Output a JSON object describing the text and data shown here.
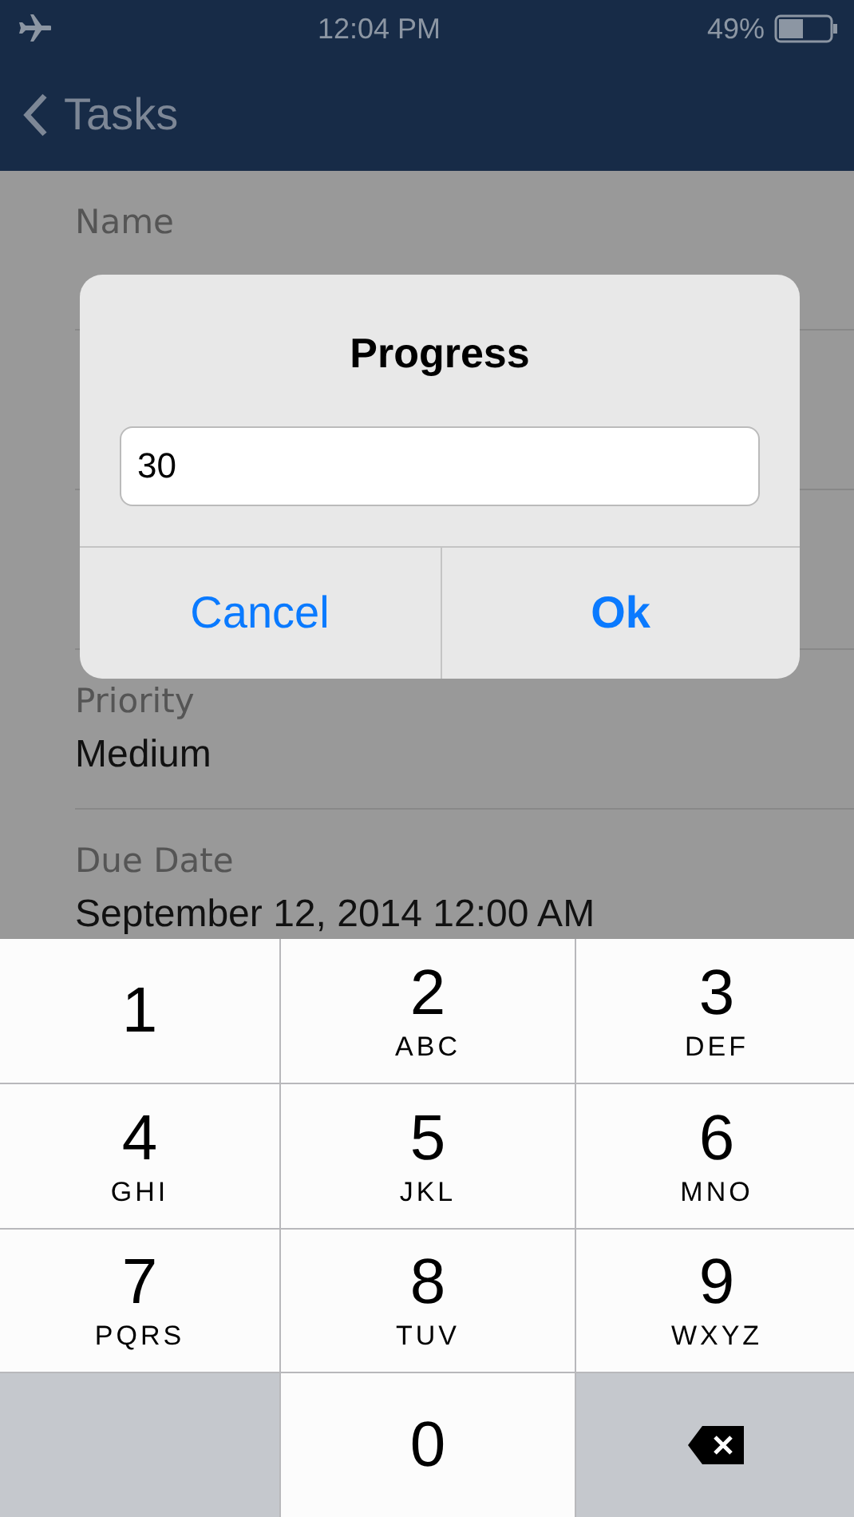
{
  "status_bar": {
    "time": "12:04 PM",
    "battery": "49%"
  },
  "nav": {
    "back_label": "Tasks"
  },
  "fields": [
    {
      "label": "Name",
      "kind": "field"
    },
    {
      "kind": "hidden"
    },
    {
      "kind": "hidden"
    },
    {
      "label": "Priority",
      "value": "Medium",
      "kind": "field"
    },
    {
      "label": "Due Date",
      "value": "September 12, 2014 12:00 AM",
      "kind": "field"
    }
  ],
  "dialog": {
    "title": "Progress",
    "value": "30",
    "buttons": [
      {
        "label": "Cancel",
        "kind": "cancel"
      },
      {
        "label": "Ok",
        "kind": "default"
      }
    ]
  },
  "keyboard": [
    {
      "kind": "digit",
      "digit": "1"
    },
    {
      "kind": "digit",
      "digit": "2",
      "letters": "ABC"
    },
    {
      "kind": "digit",
      "digit": "3",
      "letters": "DEF"
    },
    {
      "kind": "digit",
      "digit": "4",
      "letters": "GHI"
    },
    {
      "kind": "digit",
      "digit": "5",
      "letters": "JKL"
    },
    {
      "kind": "digit",
      "digit": "6",
      "letters": "MNO"
    },
    {
      "kind": "digit",
      "digit": "7",
      "letters": "PQRS"
    },
    {
      "kind": "digit",
      "digit": "8",
      "letters": "TUV"
    },
    {
      "kind": "digit",
      "digit": "9",
      "letters": "WXYZ"
    },
    {
      "kind": "blank"
    },
    {
      "kind": "digit",
      "digit": "0"
    },
    {
      "kind": "delete"
    }
  ]
}
